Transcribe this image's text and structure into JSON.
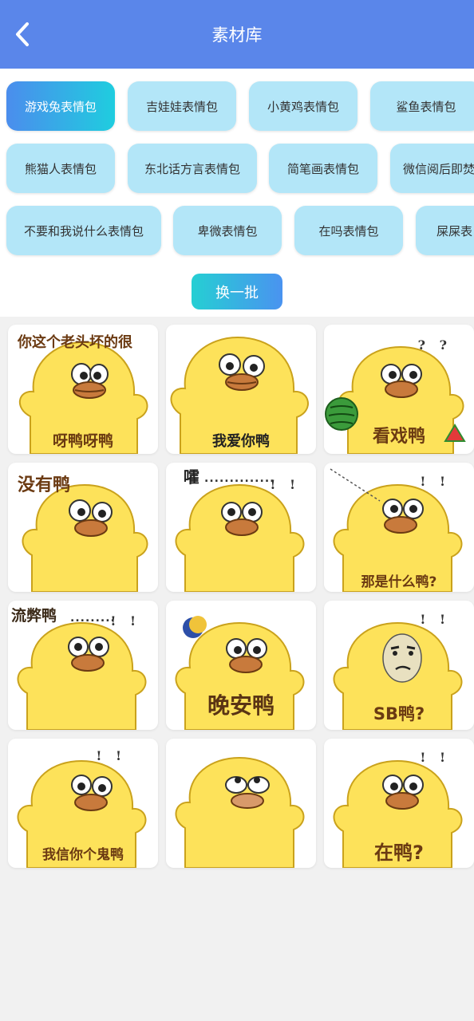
{
  "header": {
    "title": "素材库",
    "back_icon": "chevron-left-icon",
    "background": "#5a86ea"
  },
  "tags": [
    {
      "label": "游戏兔表情包",
      "active": true
    },
    {
      "label": "吉娃娃表情包",
      "active": false
    },
    {
      "label": "小黄鸡表情包",
      "active": false
    },
    {
      "label": "鲨鱼表情包",
      "active": false
    },
    {
      "label": "熊猫人表情包",
      "active": false
    },
    {
      "label": "东北话方言表情包",
      "active": false
    },
    {
      "label": "简笔画表情包",
      "active": false
    },
    {
      "label": "微信阅后即焚",
      "active": false
    },
    {
      "label": "不要和我说什么表情包",
      "active": false
    },
    {
      "label": "卑微表情包",
      "active": false
    },
    {
      "label": "在吗表情包",
      "active": false
    },
    {
      "label": "屎屎表",
      "active": false
    }
  ],
  "refresh_button": {
    "label": "换一批"
  },
  "stickers": [
    {
      "caption_top": "你这个老头坏的很",
      "caption_bottom": "呀鸭呀鸭"
    },
    {
      "caption_bottom": "我爱你鸭"
    },
    {
      "caption_bottom": "看戏鸭",
      "marks": "? ?"
    },
    {
      "caption_top": "没有鸭"
    },
    {
      "caption_top": "嚯",
      "marks": "! !"
    },
    {
      "caption_bottom": "那是什么鸭?",
      "marks": "! !"
    },
    {
      "caption_top": "流弊鸭",
      "marks": "! !"
    },
    {
      "caption_bottom": "晚安鸭"
    },
    {
      "caption_bottom": "SB鸭?",
      "marks": "! !"
    },
    {
      "caption_bottom": "我信你个鬼鸭",
      "marks": "! !"
    },
    {},
    {
      "caption_bottom": "在鸭?",
      "marks": "! !"
    }
  ]
}
